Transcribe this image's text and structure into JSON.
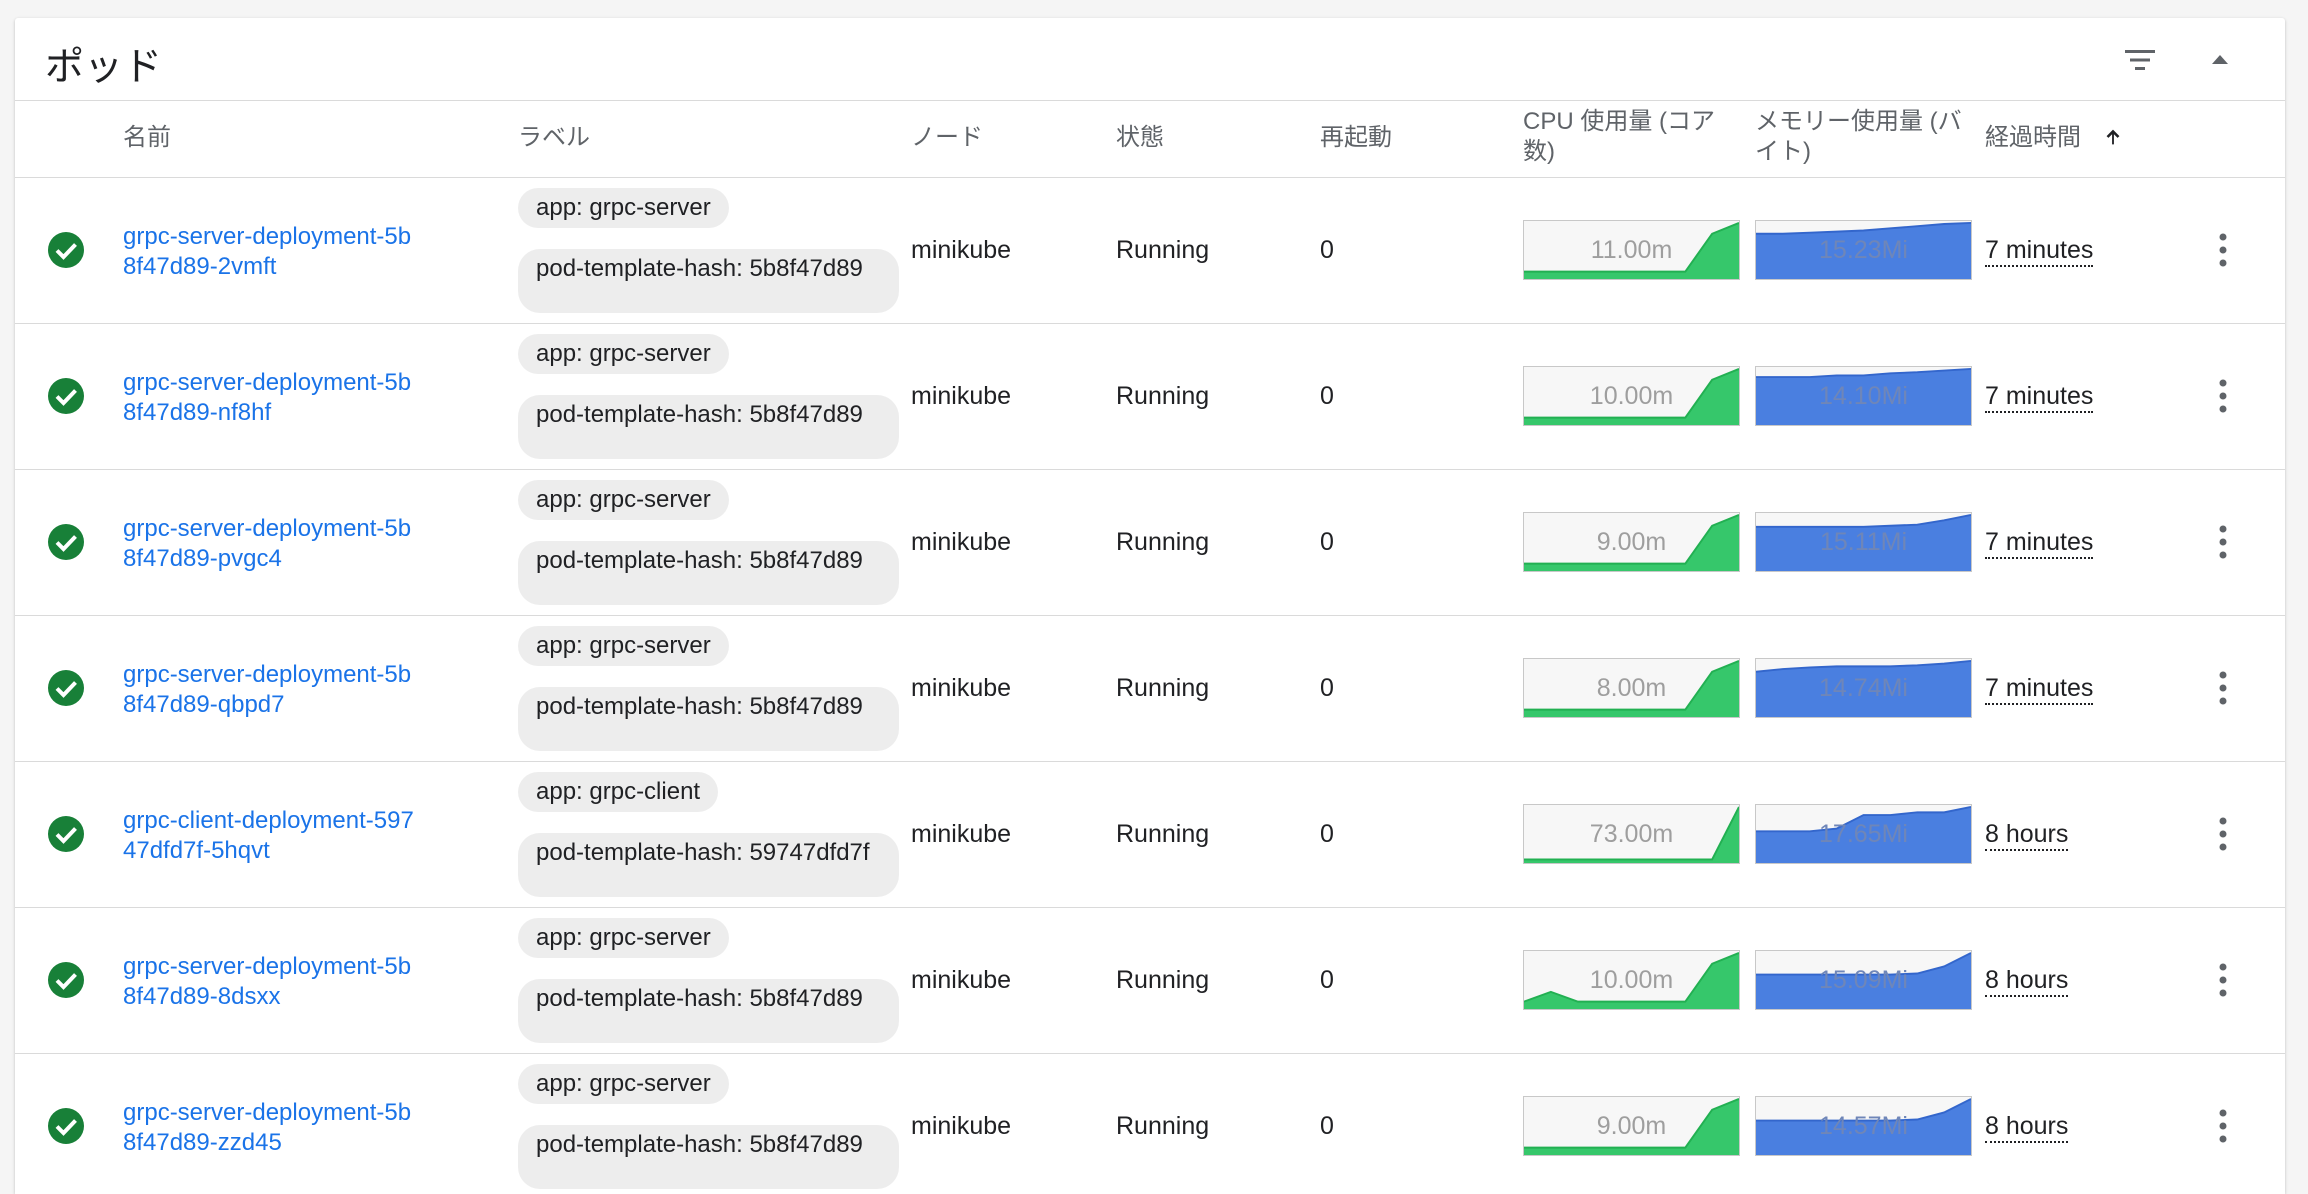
{
  "card": {
    "title": "ポッド",
    "filter_icon": "filter-list-icon",
    "collapse_icon": "chevron-up-icon"
  },
  "columns": {
    "name": "名前",
    "labels": "ラベル",
    "node": "ノード",
    "status": "状態",
    "restarts": "再起動",
    "cpu": "CPU 使用量 (コア数)",
    "memory": "メモリー使用量 (バイト)",
    "age": "経過時間",
    "age_sort_icon": "arrow-up-icon"
  },
  "colors": {
    "link": "#1a73e8",
    "status_ok": "#188038",
    "cpu_fill": "#36c76b",
    "mem_fill": "#4a7fe0",
    "chip_bg": "#ededed"
  },
  "pods": [
    {
      "name": "grpc-server-deployment-5b8f47d89-2vmft",
      "labels": [
        "app: grpc-server",
        "pod-template-hash: 5b8f47d89"
      ],
      "node": "minikube",
      "status": "Running",
      "restarts": "0",
      "cpu": "11.00m",
      "memory": "15.23Mi",
      "age": "7 minutes",
      "cpu_series": [
        0.1,
        0.1,
        0.1,
        0.1,
        0.1,
        0.1,
        0.1,
        0.8,
        1.0
      ],
      "mem_series": [
        0.8,
        0.8,
        0.82,
        0.84,
        0.86,
        0.9,
        0.94,
        0.98,
        1.0
      ]
    },
    {
      "name": "grpc-server-deployment-5b8f47d89-nf8hf",
      "labels": [
        "app: grpc-server",
        "pod-template-hash: 5b8f47d89"
      ],
      "node": "minikube",
      "status": "Running",
      "restarts": "0",
      "cpu": "10.00m",
      "memory": "14.10Mi",
      "age": "7 minutes",
      "cpu_series": [
        0.1,
        0.1,
        0.1,
        0.1,
        0.1,
        0.1,
        0.1,
        0.8,
        1.0
      ],
      "mem_series": [
        0.85,
        0.85,
        0.85,
        0.88,
        0.88,
        0.92,
        0.94,
        0.97,
        1.0
      ]
    },
    {
      "name": "grpc-server-deployment-5b8f47d89-pvgc4",
      "labels": [
        "app: grpc-server",
        "pod-template-hash: 5b8f47d89"
      ],
      "node": "minikube",
      "status": "Running",
      "restarts": "0",
      "cpu": "9.00m",
      "memory": "15.11Mi",
      "age": "7 minutes",
      "cpu_series": [
        0.1,
        0.1,
        0.1,
        0.1,
        0.1,
        0.1,
        0.1,
        0.8,
        1.0
      ],
      "mem_series": [
        0.78,
        0.78,
        0.78,
        0.78,
        0.78,
        0.8,
        0.82,
        0.9,
        1.0
      ]
    },
    {
      "name": "grpc-server-deployment-5b8f47d89-qbpd7",
      "labels": [
        "app: grpc-server",
        "pod-template-hash: 5b8f47d89"
      ],
      "node": "minikube",
      "status": "Running",
      "restarts": "0",
      "cpu": "8.00m",
      "memory": "14.74Mi",
      "age": "7 minutes",
      "cpu_series": [
        0.1,
        0.1,
        0.1,
        0.1,
        0.1,
        0.1,
        0.1,
        0.8,
        1.0
      ],
      "mem_series": [
        0.8,
        0.85,
        0.88,
        0.9,
        0.9,
        0.9,
        0.92,
        0.95,
        1.0
      ]
    },
    {
      "name": "grpc-client-deployment-59747dfd7f-5hqvt",
      "labels": [
        "app: grpc-client",
        "pod-template-hash: 59747dfd7f"
      ],
      "node": "minikube",
      "status": "Running",
      "restarts": "0",
      "cpu": "73.00m",
      "memory": "17.65Mi",
      "age": "8 hours",
      "cpu_series": [
        0.03,
        0.03,
        0.03,
        0.03,
        0.03,
        0.03,
        0.03,
        0.03,
        1.0
      ],
      "mem_series": [
        0.55,
        0.55,
        0.55,
        0.6,
        0.85,
        0.85,
        0.9,
        0.9,
        1.0
      ]
    },
    {
      "name": "grpc-server-deployment-5b8f47d89-8dsxx",
      "labels": [
        "app: grpc-server",
        "pod-template-hash: 5b8f47d89"
      ],
      "node": "minikube",
      "status": "Running",
      "restarts": "0",
      "cpu": "10.00m",
      "memory": "15.09Mi",
      "age": "8 hours",
      "cpu_series": [
        0.1,
        0.28,
        0.1,
        0.1,
        0.1,
        0.1,
        0.1,
        0.8,
        1.0
      ],
      "mem_series": [
        0.6,
        0.6,
        0.6,
        0.6,
        0.6,
        0.6,
        0.62,
        0.75,
        1.0
      ]
    },
    {
      "name": "grpc-server-deployment-5b8f47d89-zzd45",
      "labels": [
        "app: grpc-server",
        "pod-template-hash: 5b8f47d89"
      ],
      "node": "minikube",
      "status": "Running",
      "restarts": "0",
      "cpu": "9.00m",
      "memory": "14.57Mi",
      "age": "8 hours",
      "cpu_series": [
        0.1,
        0.1,
        0.1,
        0.1,
        0.1,
        0.1,
        0.1,
        0.8,
        1.0
      ],
      "mem_series": [
        0.6,
        0.6,
        0.6,
        0.6,
        0.6,
        0.6,
        0.62,
        0.75,
        1.0
      ]
    }
  ]
}
